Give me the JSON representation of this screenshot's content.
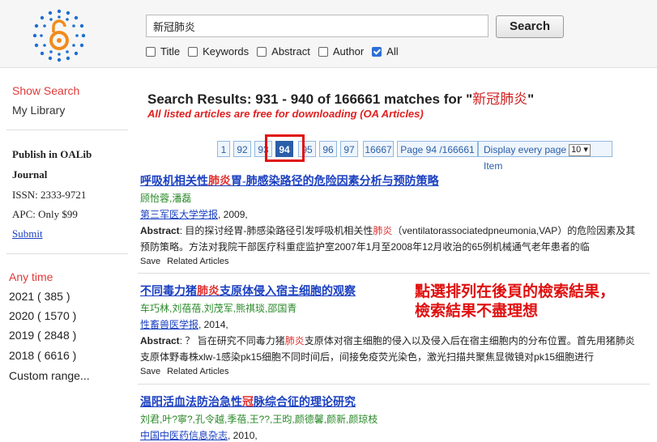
{
  "search": {
    "value": "新冠肺炎",
    "button": "Search"
  },
  "filters": [
    {
      "label": "Title",
      "checked": false
    },
    {
      "label": "Keywords",
      "checked": false
    },
    {
      "label": "Abstract",
      "checked": false
    },
    {
      "label": "Author",
      "checked": false
    },
    {
      "label": "All",
      "checked": true
    }
  ],
  "sidebar": {
    "show_search": "Show Search",
    "my_library": "My Library",
    "publish": "Publish in OALib",
    "journal": "Journal",
    "issn": "ISSN: 2333-9721",
    "apc": "APC: Only $99",
    "submit": "Submit",
    "any_time": "Any time",
    "years": [
      "2021 ( 385 )",
      "2020 ( 1570 )",
      "2019 ( 2848 )",
      "2018 ( 6616 )"
    ],
    "custom_range": "Custom range..."
  },
  "results_header": {
    "prefix": "Search Results: 931 - 940 of 166661 matches for \"",
    "keyword": "新冠肺炎",
    "suffix": "\"",
    "note": "All listed articles are free for downloading (OA Articles)"
  },
  "pagination": {
    "pages": [
      "1",
      "92",
      "93",
      "94",
      "95",
      "96",
      "97",
      "16667"
    ],
    "active": "94",
    "page_info": "Page 94 /166661",
    "display_label": "Display every page",
    "per_page": "10",
    "item_label": "Item"
  },
  "results": [
    {
      "title_pre": "呼吸机相关性",
      "title_hl": "肺炎",
      "title_post": "胃-肺感染路径的危险因素分析与预防策略",
      "authors": "顾怡蓉,潘磊",
      "journal": "第三军医大学学报",
      "year": ", 2009,",
      "abs_label": "Abstract",
      "abs_1": ": 目的探讨经胃-肺感染路径引发呼吸机相关性",
      "abs_hl": "肺炎",
      "abs_2": "（ventilatorassociatedpneumonia,VAP）的危险因素及其预防策略。方法对我院干部医疗科重症监护室2007年1月至2008年12月收治的65例机械通气老年患者的临",
      "save": "Save",
      "related": "Related Articles"
    },
    {
      "title_pre": "不同毒力猪",
      "title_hl": "肺炎",
      "title_post": "支原体侵入宿主细胞的观察",
      "authors": "车巧林,刘蓓蓓,刘茂军,熊祺琰,邵国青",
      "journal": "性畜兽医学报",
      "year": ", 2014,",
      "abs_label": "Abstract",
      "abs_1": ": ？ 旨在研究不同毒力猪",
      "abs_hl": "肺炎",
      "abs_2": "支原体对宿主细胞的侵入以及侵入后在宿主细胞内的分布位置。首先用猪肺炎支原体野毒株xlw-1感染pk15细胞不同时间后，间接免疫荧光染色，激光扫描共聚焦显微镜对pk15细胞进行",
      "save": "Save",
      "related": "Related Articles"
    },
    {
      "title_pre": "温阳活血法防治急性",
      "title_hl": "冠",
      "title_post": "脉综合征的理论研究",
      "authors": "刘君,叶?寧?,孔令越,季蓓,王??,王昀,颜德馨,颜新,颜琼枝",
      "journal": "中国中医药信息杂志",
      "year": ", 2010,"
    }
  ],
  "annotation": {
    "line1": "點選排列在後頁的檢索結果，",
    "line2": "檢索結果不盡理想"
  }
}
